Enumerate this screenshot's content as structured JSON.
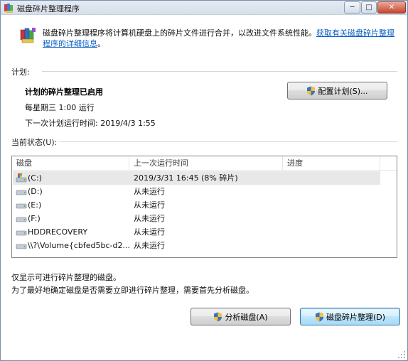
{
  "window": {
    "title": "磁盘碎片整理程序",
    "minimize_glyph": "─",
    "maximize_glyph": "□",
    "close_glyph": "✕"
  },
  "header": {
    "description": "磁盘碎片整理程序将计算机硬盘上的碎片文件进行合并，以改进文件系统性能。",
    "link": "获取有关磁盘碎片整理程序的详细信息",
    "link_suffix": "。"
  },
  "schedule": {
    "section_label": "计划:",
    "status": "计划的碎片整理已启用",
    "frequency": "每星期三  1:00 运行",
    "next_run": "下一次计划运行时间: 2019/4/3 1:55",
    "configure_button": "配置计划(S)..."
  },
  "current_status": {
    "section_label": "当前状态(U):",
    "columns": [
      "磁盘",
      "上一次运行时间",
      "进度"
    ],
    "rows": [
      {
        "disk": "(C:)",
        "last_run": "2019/3/31 16:45 (8% 碎片)",
        "progress": "",
        "icon": "system-drive-icon"
      },
      {
        "disk": "(D:)",
        "last_run": "从未运行",
        "progress": "",
        "icon": "drive-icon"
      },
      {
        "disk": "(E:)",
        "last_run": "从未运行",
        "progress": "",
        "icon": "drive-icon"
      },
      {
        "disk": "(F:)",
        "last_run": "从未运行",
        "progress": "",
        "icon": "drive-icon"
      },
      {
        "disk": "HDDRECOVERY",
        "last_run": "从未运行",
        "progress": "",
        "icon": "drive-icon"
      },
      {
        "disk": "\\\\?\\Volume{cbfed5bc-d2...",
        "last_run": "从未运行",
        "progress": "",
        "icon": "drive-icon"
      }
    ]
  },
  "footer": {
    "note1": "仅显示可进行碎片整理的磁盘。",
    "note2": "为了最好地确定磁盘是否需要立即进行碎片整理，需要首先分析磁盘。",
    "analyze_button": "分析磁盘(A)",
    "defrag_button": "磁盘碎片整理(D)"
  },
  "colors": {
    "link": "#0a5fc5",
    "titlebar": "#d6dfea",
    "selection": "#e8e8e8"
  }
}
